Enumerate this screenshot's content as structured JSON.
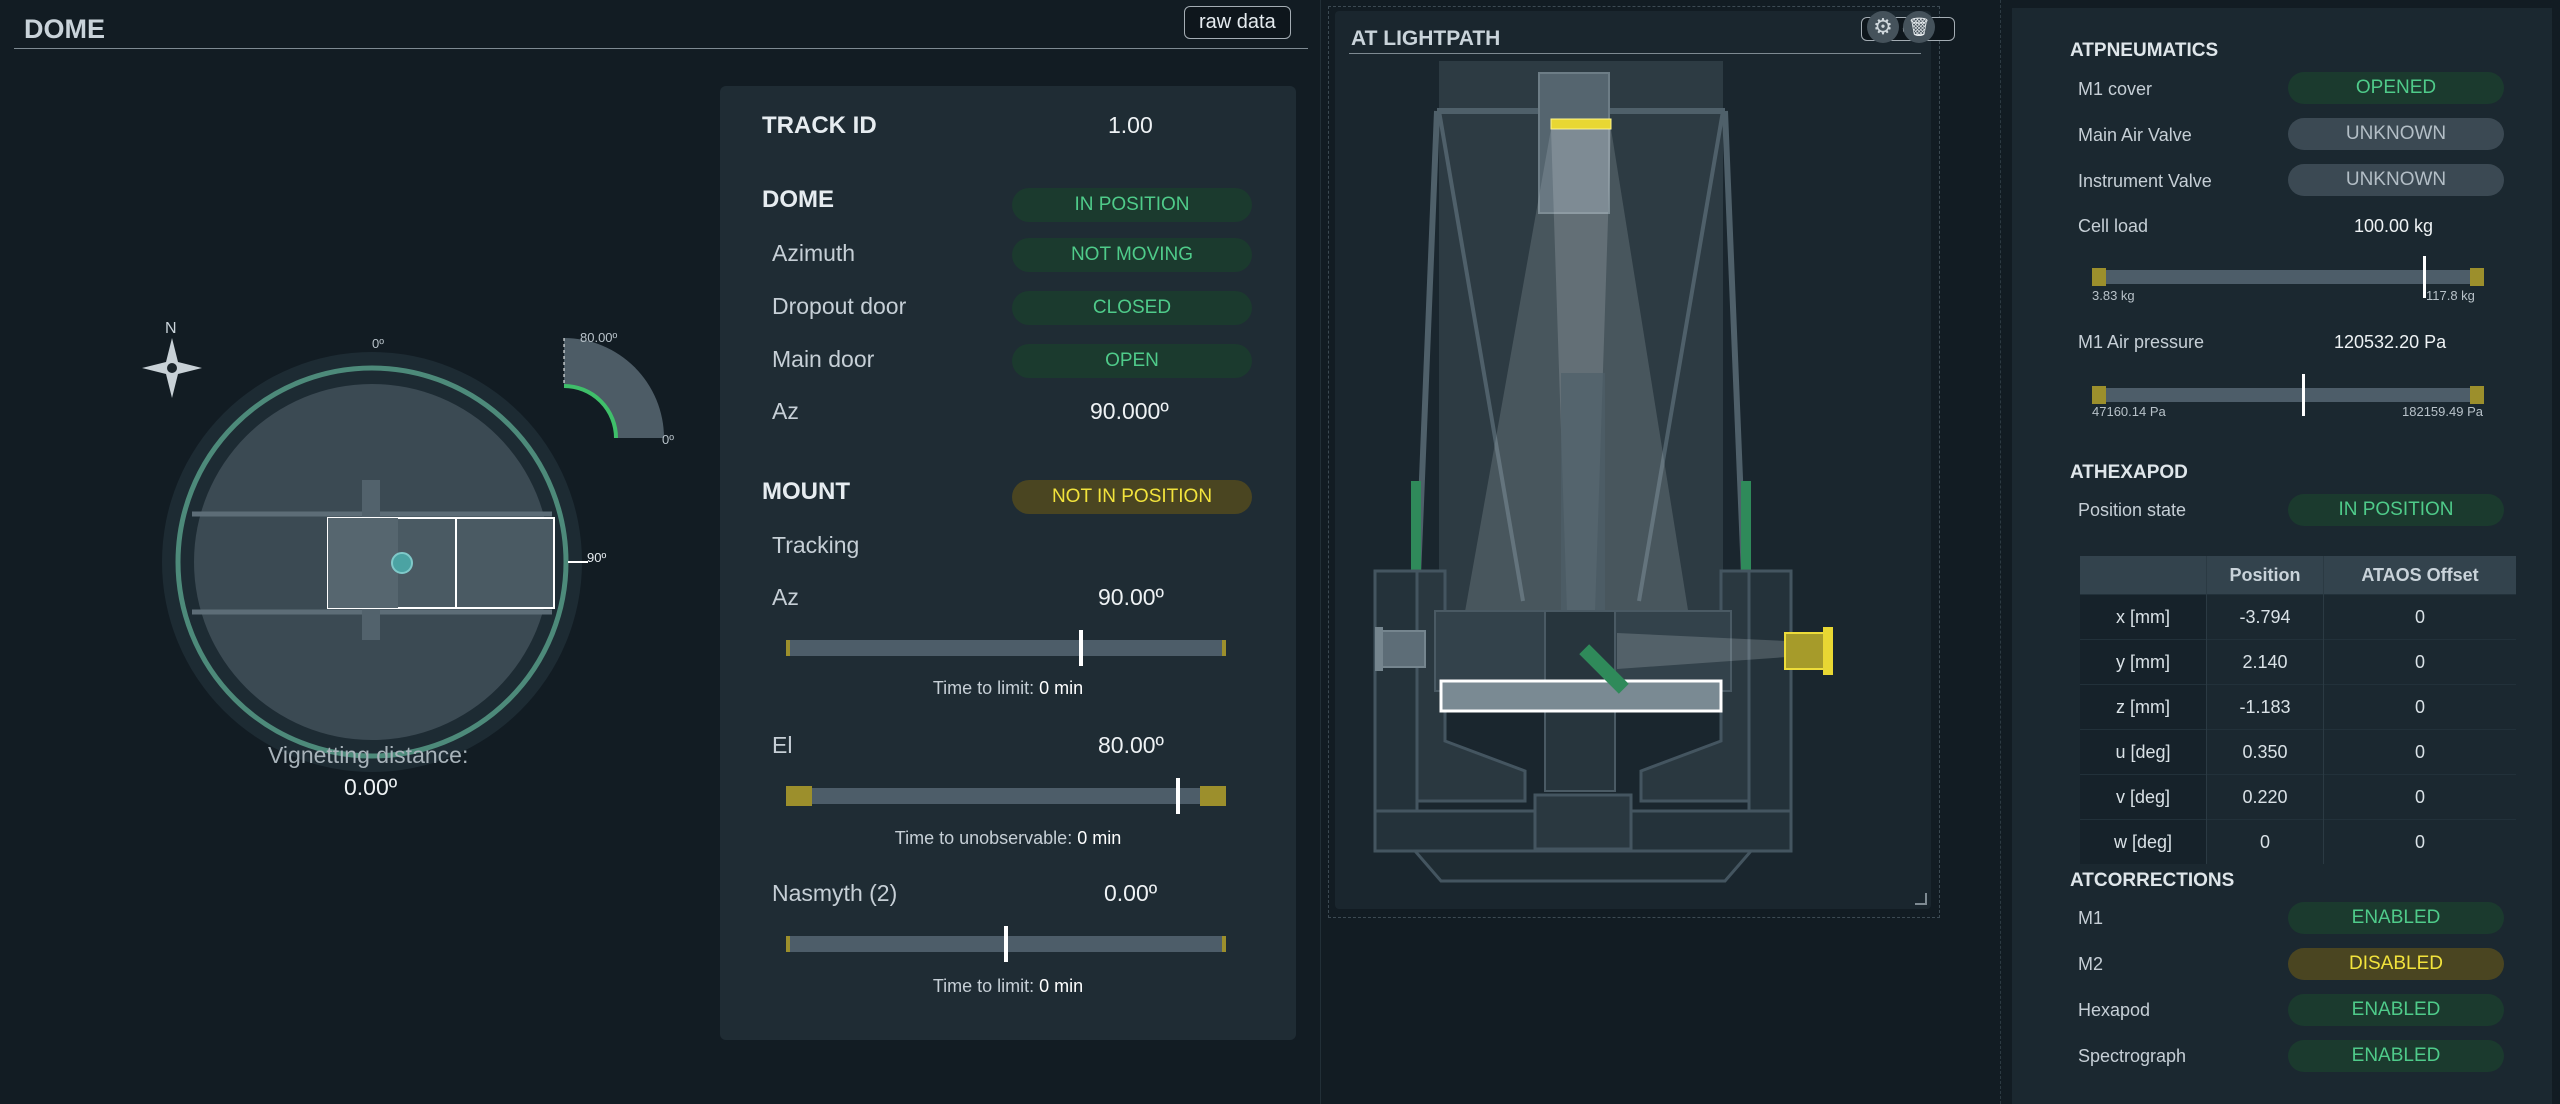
{
  "dome_panel": {
    "title": "DOME",
    "raw_data_label": "raw data",
    "compass_north": "N",
    "azimuth_ticks": {
      "top": "0º",
      "right": "90º"
    },
    "elevation_ticks": {
      "top": "80.00º",
      "right": "0º"
    },
    "vignetting_label": "Vignetting distance:",
    "vignetting_value": "0.00º"
  },
  "status": {
    "track_id_label": "TRACK ID",
    "track_id_value": "1.00",
    "dome_heading": "DOME",
    "dome_state": "IN POSITION",
    "azimuth_label": "Azimuth",
    "azimuth_state": "NOT MOVING",
    "dropout_label": "Dropout door",
    "dropout_state": "CLOSED",
    "main_door_label": "Main door",
    "main_door_state": "OPEN",
    "az_label": "Az",
    "az_value": "90.000º",
    "mount_heading": "MOUNT",
    "mount_state": "NOT IN POSITION",
    "tracking_label": "Tracking",
    "mount_az_label": "Az",
    "mount_az_value": "90.00º",
    "mount_az_time_label": "Time to limit:",
    "mount_az_time_value": "0 min",
    "el_label": "El",
    "el_value": "80.00º",
    "el_time_label": "Time to unobservable:",
    "el_time_value": "0 min",
    "nasmyth_label": "Nasmyth (2)",
    "nasmyth_value": "0.00º",
    "nasmyth_time_label": "Time to limit:",
    "nasmyth_time_value": "0 min",
    "mount_az_level": 0.67,
    "el_level": 0.89,
    "nasmyth_level": 0.5
  },
  "lightpath": {
    "title": "AT LIGHTPATH",
    "raw_data_label": "raw data"
  },
  "pneumatics": {
    "heading": "ATPNEUMATICS",
    "m1_cover_label": "M1 cover",
    "m1_cover_state": "OPENED",
    "main_valve_label": "Main Air Valve",
    "main_valve_state": "UNKNOWN",
    "instrument_valve_label": "Instrument Valve",
    "instrument_valve_state": "UNKNOWN",
    "cell_load_label": "Cell load",
    "cell_load_value": "100.00 kg",
    "cell_load_min": "3.83 kg",
    "cell_load_max": "117.8 kg",
    "cell_load_level": 0.85,
    "m1_pressure_label": "M1 Air pressure",
    "m1_pressure_value": "120532.20 Pa",
    "m1_pressure_min": "47160.14 Pa",
    "m1_pressure_max": "182159.49 Pa",
    "m1_pressure_level": 0.54
  },
  "hexapod": {
    "heading": "ATHEXAPOD",
    "position_state_label": "Position state",
    "position_state": "IN POSITION",
    "columns": [
      "",
      "Position",
      "ATAOS Offset"
    ],
    "rows": [
      [
        "x [mm]",
        "-3.794",
        "0"
      ],
      [
        "y [mm]",
        "2.140",
        "0"
      ],
      [
        "z [mm]",
        "-1.183",
        "0"
      ],
      [
        "u [deg]",
        "0.350",
        "0"
      ],
      [
        "v [deg]",
        "0.220",
        "0"
      ],
      [
        "w [deg]",
        "0",
        "0"
      ]
    ]
  },
  "corrections": {
    "heading": "ATCORRECTIONS",
    "m1_label": "M1",
    "m1_state": "ENABLED",
    "m2_label": "M2",
    "m2_state": "DISABLED",
    "hexapod_label": "Hexapod",
    "hexapod_state": "ENABLED",
    "spectrograph_label": "Spectrograph",
    "spectrograph_state": "ENABLED"
  },
  "colors": {
    "background": "#121c23",
    "ok": "#4fcb8a",
    "warn": "#f2e33c",
    "accent_yellow": "#e0d23a"
  },
  "icons": [
    "compass-icon",
    "gear-icon",
    "trash-icon",
    "resize-handle-icon"
  ]
}
